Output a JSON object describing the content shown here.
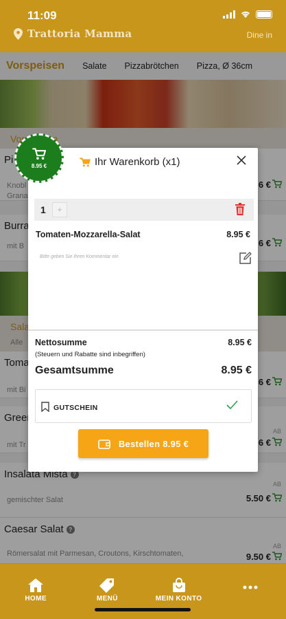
{
  "status": {
    "time": "11:09"
  },
  "header": {
    "restaurant": "Trattoria Mamma",
    "mode": "Dine in"
  },
  "tabs": [
    {
      "label": "Vorspeisen",
      "active": true
    },
    {
      "label": "Salate"
    },
    {
      "label": "Pizzabrötchen"
    },
    {
      "label": "Pizza, Ø 36cm"
    }
  ],
  "sections": {
    "vorspeisen": {
      "title": "Vorspeisen"
    },
    "salate": {
      "title": "Salate",
      "subtitle": "Alle"
    }
  },
  "items": [
    {
      "name": "Pi",
      "desc": "Knobl",
      "desc2": "Grana",
      "price": "6 €"
    },
    {
      "name": "Burra",
      "desc": "mit B",
      "price": "6 €"
    },
    {
      "name": "Toma",
      "desc": "mit Bi",
      "price": "6 €"
    },
    {
      "name": "Green",
      "desc": "mit Tr",
      "price": "6 €",
      "ab": "AB"
    },
    {
      "name": "Insalata Mista",
      "desc": "gemischter Salat",
      "price": "5.50 €",
      "ab": "AB"
    },
    {
      "name": "Caesar Salat",
      "desc": "Römersalat mit Parmesan, Croutons, Kirschtomaten,",
      "price": "9.50 €",
      "ab": "AB"
    }
  ],
  "cart_bubble": {
    "total": "8.95 €"
  },
  "cart": {
    "title": "Ihr Warenkorb (x1)",
    "qty": "1",
    "plus": "+",
    "line": {
      "name": "Tomaten-Mozzarella-Salat",
      "price": "8.95 €"
    },
    "comment_placeholder": "Bitte geben Sie Ihren Kommentar ein",
    "net_label": "Nettosumme",
    "net_note": "(Steuern und Rabatte sind inbegriffen)",
    "net_value": "8.95 €",
    "total_label": "Gesamtsumme",
    "total_value": "8.95 €",
    "voucher_label": "GUTSCHEIN",
    "order_button": "Bestellen 8.95 €"
  },
  "nav": [
    {
      "label": "HOME",
      "icon": "home-icon"
    },
    {
      "label": "MENÜ",
      "icon": "tag-icon"
    },
    {
      "label": "MEIN KONTO",
      "icon": "bag-icon"
    },
    {
      "label": "",
      "icon": "more-icon"
    }
  ],
  "colors": {
    "brand": "#c9961c",
    "accent": "#f5a515",
    "cart_green": "#1b7d1b",
    "danger": "#e03131"
  }
}
